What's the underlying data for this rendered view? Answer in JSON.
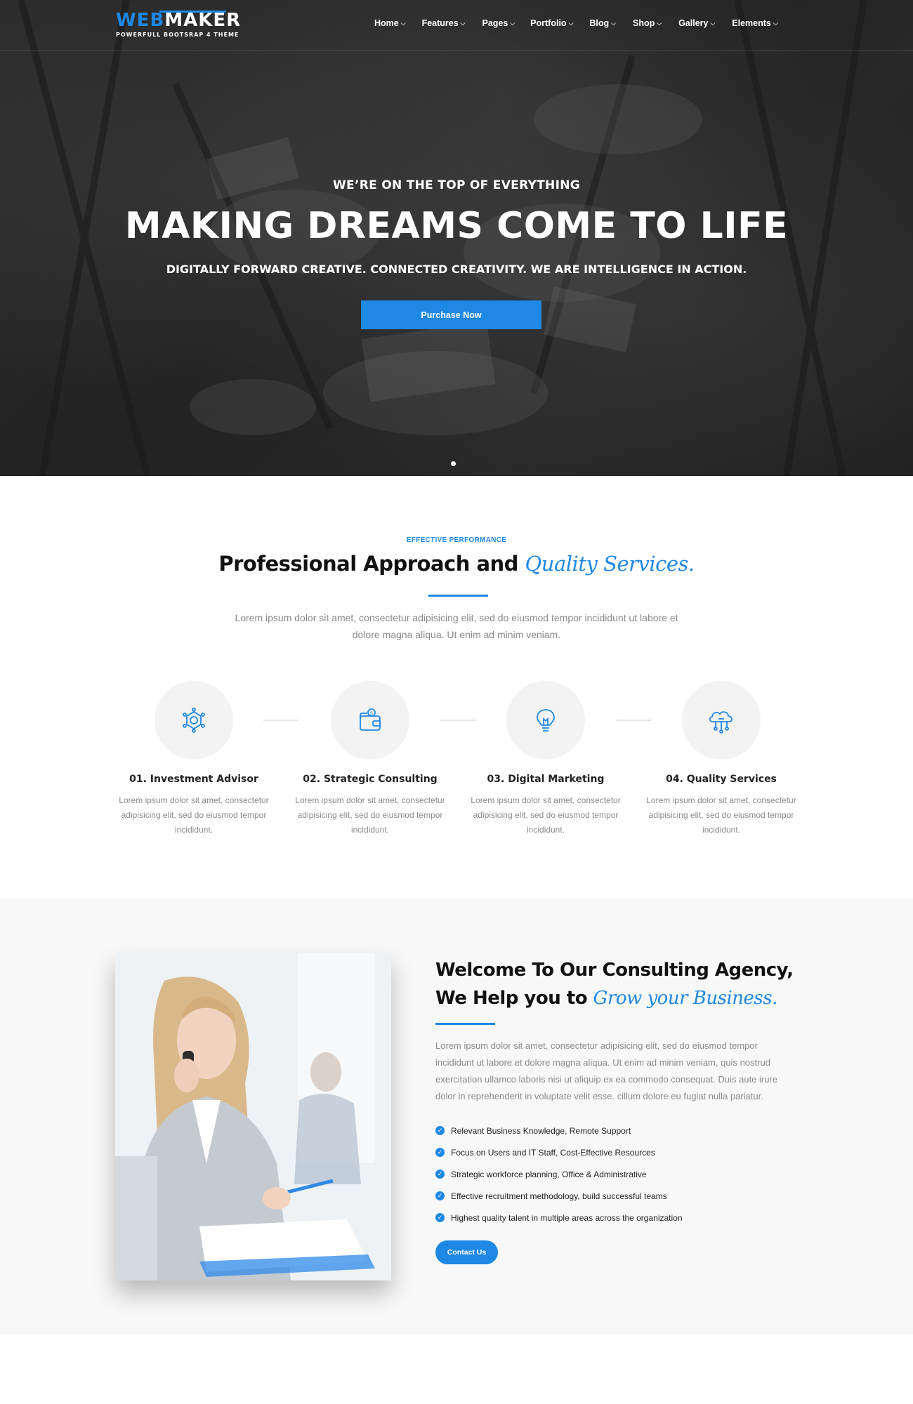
{
  "brand": {
    "logo_part1": "WEB",
    "logo_part2": "MAKER",
    "tagline": "POWERFULL BOOTSRAP 4 THEME",
    "accent_color": "#1e88e5"
  },
  "nav": {
    "items": [
      {
        "label": "Home",
        "icon": "chevron-down-icon"
      },
      {
        "label": "Features",
        "icon": "chevron-down-icon"
      },
      {
        "label": "Pages",
        "icon": "chevron-down-icon"
      },
      {
        "label": "Portfolio",
        "icon": "chevron-down-icon"
      },
      {
        "label": "Blog",
        "icon": "chevron-down-icon"
      },
      {
        "label": "Shop",
        "icon": "chevron-down-icon"
      },
      {
        "label": "Gallery",
        "icon": "chevron-down-icon"
      },
      {
        "label": "Elements",
        "icon": "chevron-down-icon"
      }
    ]
  },
  "hero": {
    "kicker": "WE’RE ON THE TOP OF EVERYTHING",
    "title": "MAKING DREAMS COME TO LIFE",
    "subtitle": "DIGITALLY FORWARD CREATIVE. CONNECTED CREATIVITY. WE ARE INTELLIGENCE IN ACTION.",
    "button_label": "Purchase Now"
  },
  "services_section": {
    "kicker": "EFFECTIVE PERFORMANCE",
    "title_plain": "Professional Approach and ",
    "title_accent": "Quality Services.",
    "description": "Lorem ipsum dolor sit amet, consectetur adipisicing elit, sed do eiusmod tempor incididunt ut labore et dolore magna aliqua. Ut enim ad minim veniam.",
    "items": [
      {
        "title": "01. Investment Advisor",
        "text": "Lorem ipsum dolor sit amet, consectetur adipisicing elit, sed do eiusmod tempor incididunt.",
        "icon": "gear-icon"
      },
      {
        "title": "02. Strategic Consulting",
        "text": "Lorem ipsum dolor sit amet, consectetur adipisicing elit, sed do eiusmod tempor incididunt.",
        "icon": "wallet-icon"
      },
      {
        "title": "03. Digital Marketing",
        "text": "Lorem ipsum dolor sit amet, consectetur adipisicing elit, sed do eiusmod tempor incididunt.",
        "icon": "lightbulb-icon"
      },
      {
        "title": "04. Quality Services",
        "text": "Lorem ipsum dolor sit amet, consectetur adipisicing elit, sed do eiusmod tempor incididunt.",
        "icon": "cloud-network-icon"
      }
    ]
  },
  "about": {
    "title_plain": "Welcome To Our Consulting Agency, We Help you to ",
    "title_accent": "Grow your Business.",
    "description": "Lorem ipsum dolor sit amet, consectetur adipisicing elit, sed do eiusmod tempor incididunt ut labore et dolore magna aliqua. Ut enim ad minim veniam, quis nostrud exercitation ullamco laboris nisi ut aliquip ex ea commodo consequat. Duis aute irure dolor in reprehenderit in voluptate velit esse. cillum dolore eu fugiat nulla pariatur.",
    "checklist": [
      "Relevant Business Knowledge, Remote Support",
      "Focus on Users and IT Staff, Cost-Effective Resources",
      "Strategic workforce planning, Office & Administrative",
      "Effective recruitment methodology, build successful teams",
      "Highest quality talent in multiple areas across the organization"
    ],
    "button_label": "Contact Us"
  }
}
